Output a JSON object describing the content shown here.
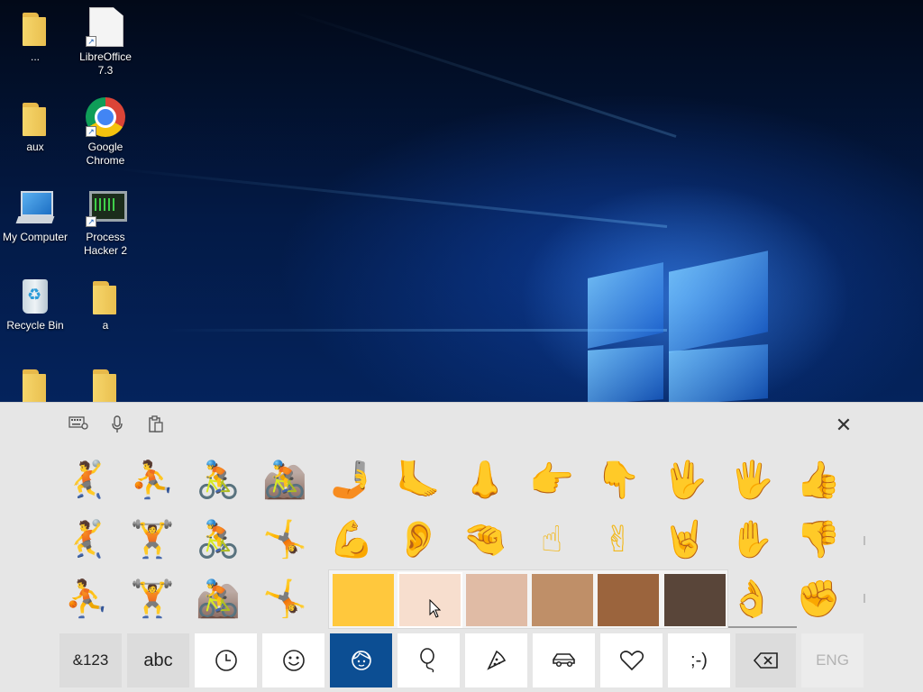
{
  "desktop": {
    "icons": [
      {
        "label": "...",
        "icon": "folder-icon"
      },
      {
        "label": "LibreOffice 7.3",
        "icon": "libreoffice-icon"
      },
      {
        "label": "aux",
        "icon": "folder-icon"
      },
      {
        "label": "Google Chrome",
        "icon": "chrome-icon"
      },
      {
        "label": "My Computer",
        "icon": "computer-icon"
      },
      {
        "label": "Process Hacker 2",
        "icon": "process-hacker-icon"
      },
      {
        "label": "Recycle Bin",
        "icon": "recycle-bin-icon"
      },
      {
        "label": "a",
        "icon": "folder-icon"
      },
      {
        "label": "",
        "icon": "folder-icon"
      },
      {
        "label": "",
        "icon": "folder-icon"
      }
    ]
  },
  "keyboard": {
    "toolbar": {
      "settings_icon": "keyboard-settings-icon",
      "mic_icon": "microphone-icon",
      "clipboard_icon": "clipboard-icon",
      "close_glyph": "✕"
    },
    "emoji_rows": [
      [
        "🤾",
        "⛹",
        "🚴",
        "🚵",
        "🤳",
        "🦶",
        "👃",
        "👉",
        "👇",
        "🖖",
        "🖐",
        "👍"
      ],
      [
        "🤾",
        "🏋",
        "🚴",
        "🤸",
        "💪",
        "👂",
        "🤏",
        "☝",
        "✌",
        "🤘",
        "✋",
        "👎"
      ],
      [
        "⛹",
        "🏋",
        "🚵",
        "🤸",
        "",
        "",
        "",
        "",
        "",
        "",
        "👌",
        "✊"
      ]
    ],
    "skin_tones": [
      "#FFC83D",
      "#F7DECE",
      "#E0BBA5",
      "#BF8F68",
      "#9B643D",
      "#594539"
    ],
    "selected_tone_index": 1,
    "bottom_keys": [
      {
        "label": "&123",
        "icon": ""
      },
      {
        "label": "abc",
        "icon": ""
      },
      {
        "label": "",
        "icon": "recent-clock-icon"
      },
      {
        "label": "",
        "icon": "smiley-icon"
      },
      {
        "label": "",
        "icon": "people-icon"
      },
      {
        "label": "",
        "icon": "balloon-icon"
      },
      {
        "label": "",
        "icon": "pizza-icon"
      },
      {
        "label": "",
        "icon": "car-icon"
      },
      {
        "label": "",
        "icon": "heart-icon"
      },
      {
        "label": ";-)",
        "icon": ""
      },
      {
        "label": "",
        "icon": "backspace-icon"
      },
      {
        "label": "ENG",
        "icon": ""
      }
    ],
    "active_category": "people",
    "accent_color": "#0C4E93"
  }
}
